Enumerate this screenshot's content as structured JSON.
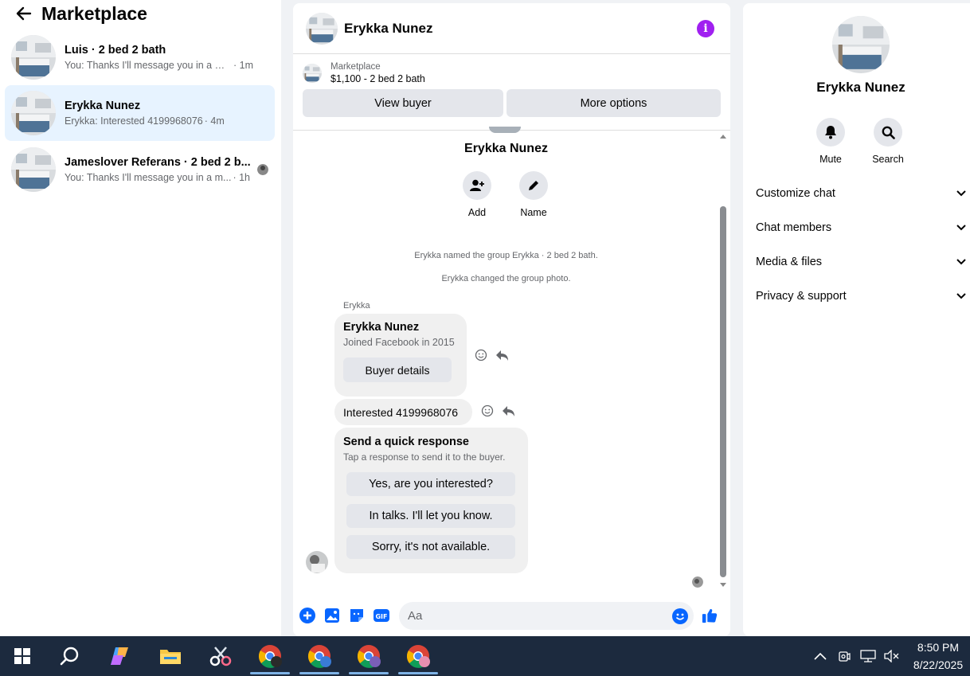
{
  "left": {
    "title": "Marketplace",
    "conversations": [
      {
        "title": "Luis · 2 bed 2 bath",
        "snippet": "You: Thanks I'll message you in a mo...",
        "time": "· 1m"
      },
      {
        "title": "Erykka Nunez",
        "snippet": "Erykka: Interested 4199968076",
        "time": "· 4m"
      },
      {
        "title": "Jameslover Referans · 2 bed 2 b...",
        "snippet": "You: Thanks I'll message you in a m...",
        "time": "· 1h"
      }
    ]
  },
  "chat": {
    "name": "Erykka Nunez",
    "listing": {
      "label": "Marketplace",
      "price": "$1,100 - 2 bed 2 bath",
      "view_buyer": "View buyer",
      "more_options": "More options"
    },
    "group_name": "Erykka Nunez",
    "add_label": "Add",
    "name_label": "Name",
    "system_1": "Erykka named the group Erykka · 2 bed 2 bath.",
    "system_2": "Erykka changed the group photo.",
    "sender": "Erykka",
    "card": {
      "name": "Erykka Nunez",
      "sub": "Joined Facebook in 2015",
      "button": "Buyer details"
    },
    "message": "Interested 4199968076",
    "quick": {
      "title": "Send a quick response",
      "sub": "Tap a response to send it to the buyer.",
      "options": [
        "Yes, are you interested?",
        "In talks. I'll let you know.",
        "Sorry, it's not available."
      ]
    },
    "placeholder": "Aa"
  },
  "right": {
    "name": "Erykka Nunez",
    "mute": "Mute",
    "search": "Search",
    "sections": [
      "Customize chat",
      "Chat members",
      "Media & files",
      "Privacy & support"
    ]
  },
  "taskbar": {
    "time": "8:50 PM",
    "date": "8/22/2025"
  },
  "colors": {
    "accent": "#0866ff",
    "info": "#a020f0",
    "active_bg": "#e7f3ff",
    "taskbar": "#1c2a3e"
  }
}
